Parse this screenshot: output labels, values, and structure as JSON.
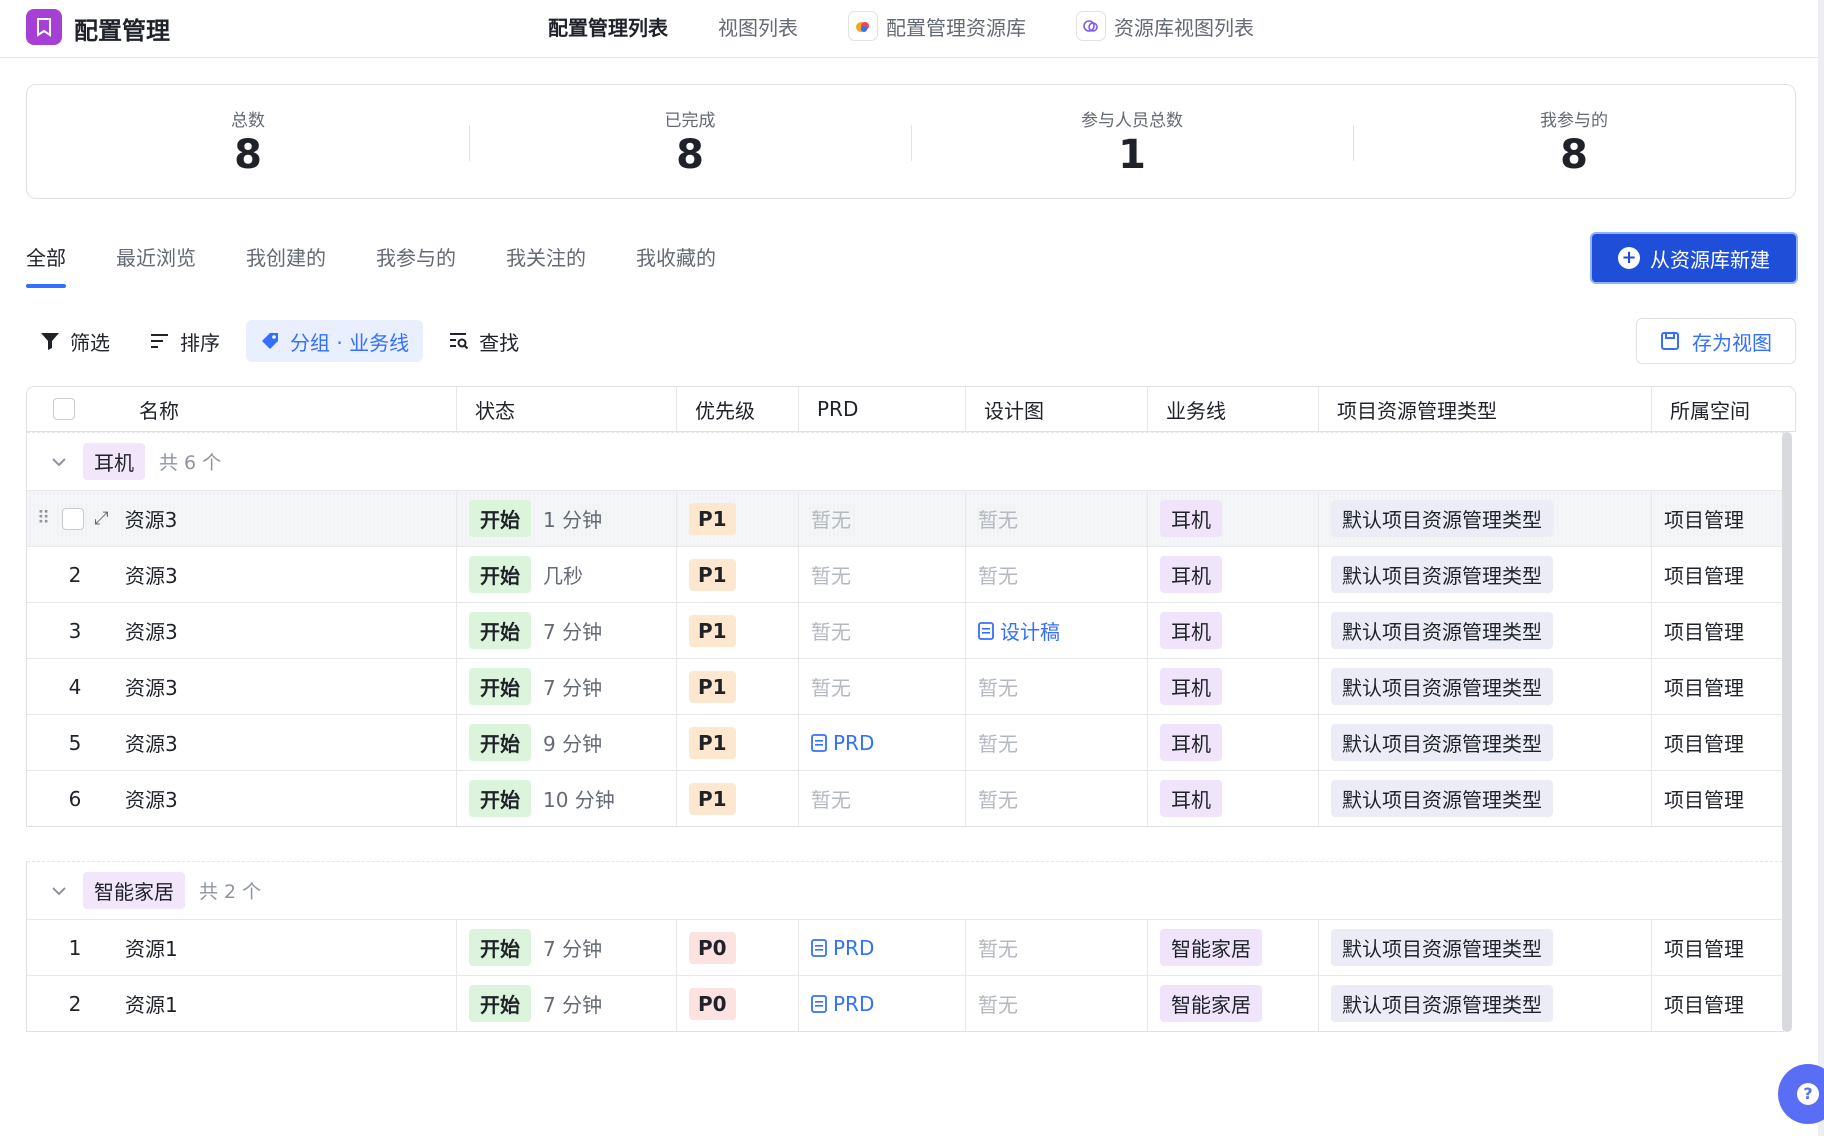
{
  "header": {
    "app_title": "配置管理",
    "tabs": [
      {
        "label": "配置管理列表"
      },
      {
        "label": "视图列表"
      },
      {
        "label": "配置管理资源库"
      },
      {
        "label": "资源库视图列表"
      }
    ]
  },
  "stats": [
    {
      "label": "总数",
      "value": "8"
    },
    {
      "label": "已完成",
      "value": "8"
    },
    {
      "label": "参与人员总数",
      "value": "1"
    },
    {
      "label": "我参与的",
      "value": "8"
    }
  ],
  "filter_tabs": [
    "全部",
    "最近浏览",
    "我创建的",
    "我参与的",
    "我关注的",
    "我收藏的"
  ],
  "new_button_label": "从资源库新建",
  "toolbar": {
    "filter": "筛选",
    "sort": "排序",
    "group": "分组 · 业务线",
    "find": "查找",
    "save_view": "存为视图"
  },
  "columns": [
    "名称",
    "状态",
    "优先级",
    "PRD",
    "设计图",
    "业务线",
    "项目资源管理类型",
    "所属空间"
  ],
  "groups": [
    {
      "name": "耳机",
      "count": "共 6 个",
      "rows": [
        {
          "idx": "",
          "name": "资源3",
          "status": "开始",
          "time": "1 分钟",
          "priority": "P1",
          "prd": "暂无",
          "design": "暂无",
          "line": "耳机",
          "type": "默认项目资源管理类型",
          "space": "项目管理"
        },
        {
          "idx": "2",
          "name": "资源3",
          "status": "开始",
          "time": "几秒",
          "priority": "P1",
          "prd": "暂无",
          "design": "暂无",
          "line": "耳机",
          "type": "默认项目资源管理类型",
          "space": "项目管理"
        },
        {
          "idx": "3",
          "name": "资源3",
          "status": "开始",
          "time": "7 分钟",
          "priority": "P1",
          "prd": "暂无",
          "design": "设计稿",
          "line": "耳机",
          "type": "默认项目资源管理类型",
          "space": "项目管理"
        },
        {
          "idx": "4",
          "name": "资源3",
          "status": "开始",
          "time": "7 分钟",
          "priority": "P1",
          "prd": "暂无",
          "design": "暂无",
          "line": "耳机",
          "type": "默认项目资源管理类型",
          "space": "项目管理"
        },
        {
          "idx": "5",
          "name": "资源3",
          "status": "开始",
          "time": "9 分钟",
          "priority": "P1",
          "prd": "PRD",
          "design": "暂无",
          "line": "耳机",
          "type": "默认项目资源管理类型",
          "space": "项目管理"
        },
        {
          "idx": "6",
          "name": "资源3",
          "status": "开始",
          "time": "10 分钟",
          "priority": "P1",
          "prd": "暂无",
          "design": "暂无",
          "line": "耳机",
          "type": "默认项目资源管理类型",
          "space": "项目管理"
        }
      ]
    },
    {
      "name": "智能家居",
      "count": "共 2 个",
      "rows": [
        {
          "idx": "1",
          "name": "资源1",
          "status": "开始",
          "time": "7 分钟",
          "priority": "P0",
          "prd": "PRD",
          "design": "暂无",
          "line": "智能家居",
          "type": "默认项目资源管理类型",
          "space": "项目管理"
        },
        {
          "idx": "2",
          "name": "资源1",
          "status": "开始",
          "time": "7 分钟",
          "priority": "P0",
          "prd": "PRD",
          "design": "暂无",
          "line": "智能家居",
          "type": "默认项目资源管理类型",
          "space": "项目管理"
        }
      ]
    }
  ],
  "colors": {
    "primary": "#3370ff",
    "button": "#1f4fd8",
    "app_logo": "#a63fd6"
  },
  "icons": [
    "bookmark-icon",
    "filter-icon",
    "sort-icon",
    "tag-icon",
    "search-icon",
    "save-icon",
    "plus-icon",
    "doc-icon",
    "help-icon",
    "chevron-down-icon",
    "drag-handle-icon",
    "expand-icon"
  ]
}
